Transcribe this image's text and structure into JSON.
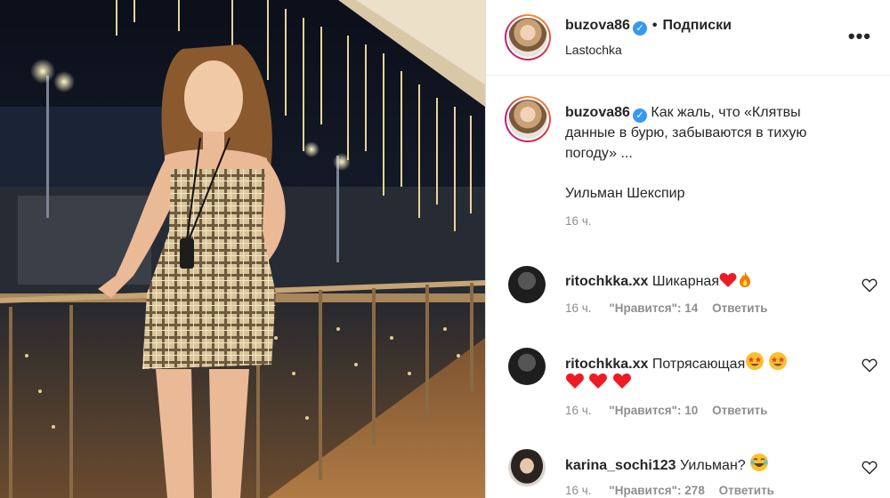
{
  "post": {
    "username": "buzova86",
    "follow_label": "Подписки",
    "location": "Lastochka",
    "more_label": "•••",
    "caption": {
      "username": "buzova86",
      "text_line1": "Как жаль, что «Клятвы",
      "text_line2": "данные в бурю, забываются в тихую",
      "text_line3": "погоду» ...",
      "author": "Уильман Шекспир",
      "time": "16 ч."
    }
  },
  "comments": [
    {
      "username": "ritochkka.xx",
      "text": "Шикарная",
      "emojis": [
        "heart-icon",
        "fire-icon"
      ],
      "time": "16 ч.",
      "likes": "\"Нравится\": 14",
      "reply": "Ответить"
    },
    {
      "username": "ritochkka.xx",
      "text": "Потрясающая",
      "emojis": [
        "star-eyes-icon",
        "star-eyes-icon",
        "heart-icon",
        "heart-icon",
        "heart-icon"
      ],
      "time": "16 ч.",
      "likes": "\"Нравится\": 10",
      "reply": "Ответить"
    },
    {
      "username": "karina_sochi123",
      "text": "Уильман?",
      "emojis": [
        "laughing-icon"
      ],
      "time": "16 ч.",
      "likes": "\"Нравится\": 278",
      "reply": "Ответить"
    }
  ],
  "colors": {
    "verified": "#3897f0",
    "heart": "#ed4956",
    "muted": "#8e8e8e",
    "text": "#262626"
  }
}
